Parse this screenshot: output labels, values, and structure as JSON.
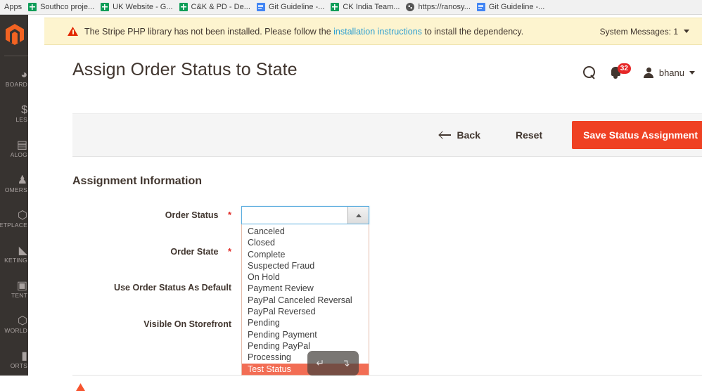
{
  "browser": {
    "apps_label": "Apps",
    "bookmarks": [
      {
        "label": "Southco proje...",
        "icon": "sheets-icon"
      },
      {
        "label": "UK Website - G...",
        "icon": "sheets-icon"
      },
      {
        "label": "C&K & PD - De...",
        "icon": "sheets-icon"
      },
      {
        "label": "Git Guideline -...",
        "icon": "docs-icon"
      },
      {
        "label": "CK India Team...",
        "icon": "sheets-icon"
      },
      {
        "label": "https://ranosy...",
        "icon": "globe-icon"
      },
      {
        "label": "Git Guideline -...",
        "icon": "docs-icon"
      }
    ]
  },
  "sidebar": {
    "items": [
      {
        "label": "BOARD",
        "glyph": "◔"
      },
      {
        "label": "LES",
        "glyph": "$"
      },
      {
        "label": "ALOG",
        "glyph": "▤"
      },
      {
        "label": "OMERS",
        "glyph": "♟"
      },
      {
        "label": "MS\nETPLACE",
        "glyph": "⬡"
      },
      {
        "label": "KETING",
        "glyph": "📣"
      },
      {
        "label": "TENT",
        "glyph": "▣"
      },
      {
        "label": "WORLD",
        "glyph": "⬡"
      },
      {
        "label": "ORTS",
        "glyph": "▮"
      }
    ]
  },
  "banner": {
    "text_before": "The Stripe PHP library has not been installed. Please follow the ",
    "link_text": "installation instructions",
    "text_after": " to install the dependency.",
    "system_messages_label": "System Messages: 1"
  },
  "header": {
    "title": "Assign Order Status to State",
    "notification_count": "32",
    "user_name": "bhanu"
  },
  "actions": {
    "back_label": "Back",
    "reset_label": "Reset",
    "save_label": "Save Status Assignment",
    "save_color": "#ef4123"
  },
  "form": {
    "section_title": "Assignment Information",
    "fields": [
      {
        "label": "Order Status",
        "required": true
      },
      {
        "label": "Order State",
        "required": true
      },
      {
        "label": "Use Order Status As Default",
        "required": false
      },
      {
        "label": "Visible On Storefront",
        "required": false
      }
    ],
    "order_status_select": {
      "value": "",
      "expanded": true,
      "options": [
        "Canceled",
        "Closed",
        "Complete",
        "Suspected Fraud",
        "On Hold",
        "Payment Review",
        "PayPal Canceled Reversal",
        "PayPal Reversed",
        "Pending",
        "Pending Payment",
        "Pending PayPal",
        "Processing",
        "Test Status"
      ],
      "selected_option": "Test Status",
      "highlight_color": "#f26d54"
    }
  },
  "overlay": {
    "glyph_left": "↵",
    "glyph_right": "↴"
  }
}
